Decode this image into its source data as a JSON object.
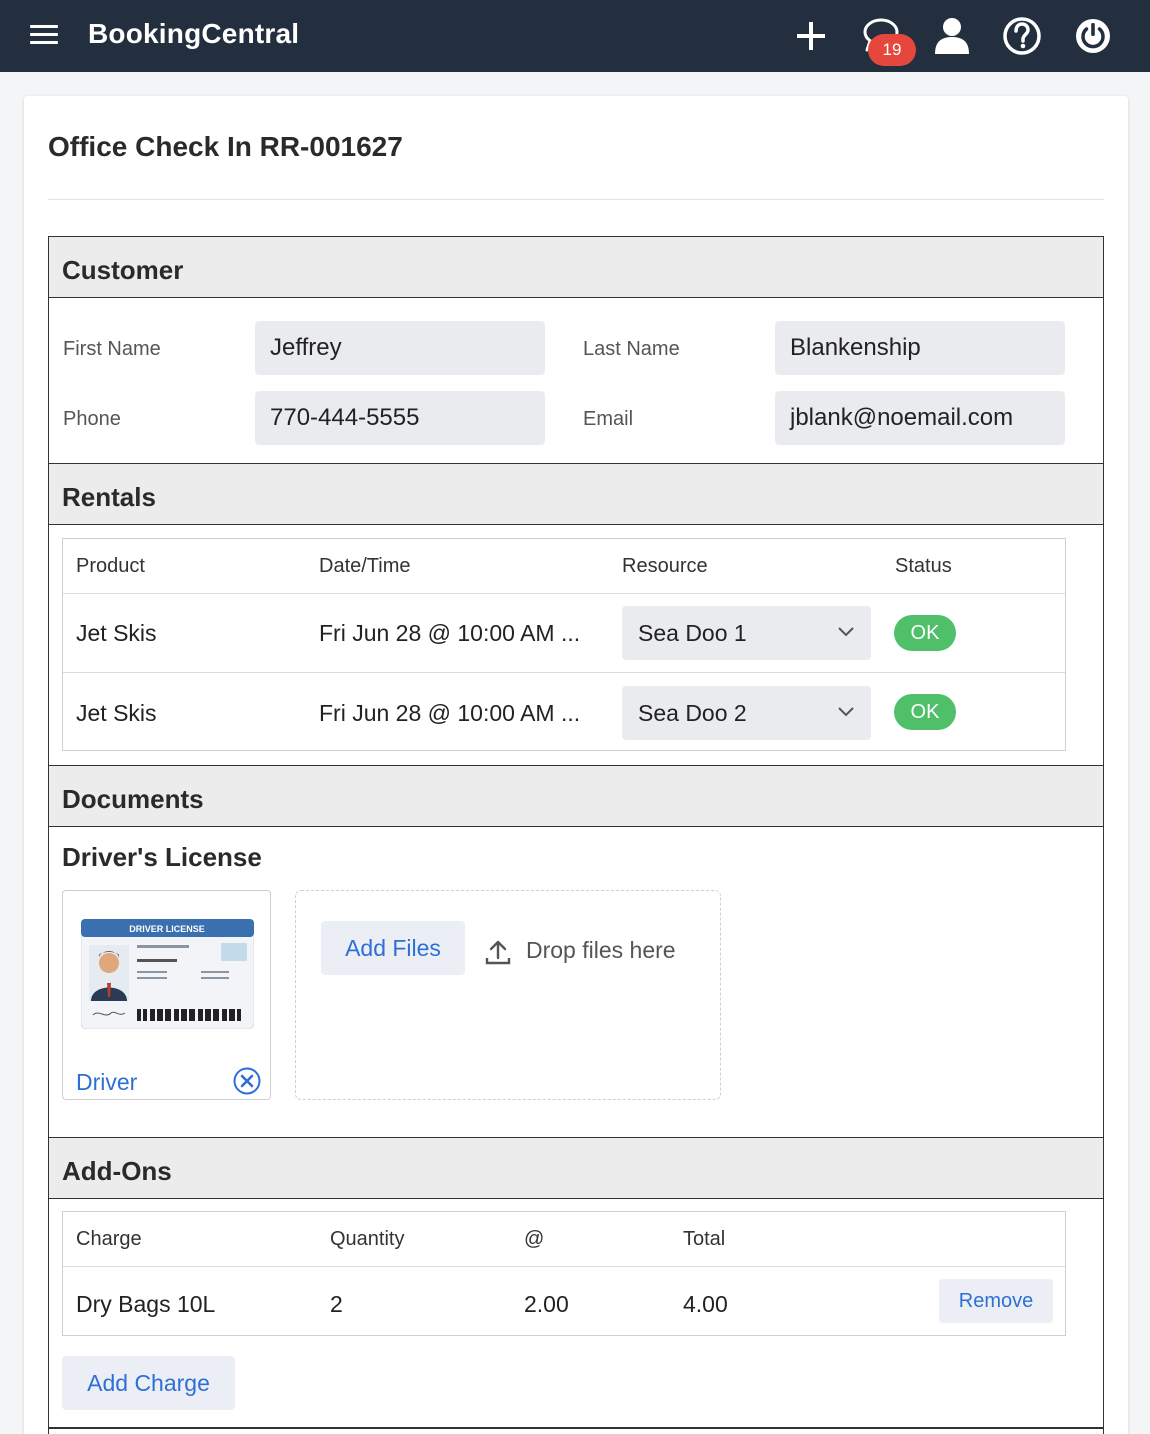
{
  "app": {
    "brand": "BookingCentral",
    "notification_count": "19",
    "icons": [
      "menu-icon",
      "plus-icon",
      "chat-icon",
      "user-icon",
      "help-icon",
      "power-icon"
    ]
  },
  "page": {
    "title": "Office Check In RR-001627"
  },
  "customer": {
    "heading": "Customer",
    "first_name_label": "First Name",
    "first_name": "Jeffrey",
    "last_name_label": "Last Name",
    "last_name": "Blankenship",
    "phone_label": "Phone",
    "phone": "770-444-5555",
    "email_label": "Email",
    "email": "jblank@noemail.com"
  },
  "rentals": {
    "heading": "Rentals",
    "columns": [
      "Product",
      "Date/Time",
      "Resource",
      "Status"
    ],
    "rows": [
      {
        "product": "Jet Skis",
        "datetime": "Fri Jun 28 @ 10:00 AM ...",
        "resource": "Sea Doo 1",
        "status": "OK"
      },
      {
        "product": "Jet Skis",
        "datetime": "Fri Jun 28 @ 10:00 AM ...",
        "resource": "Sea Doo 2",
        "status": "OK"
      }
    ]
  },
  "documents": {
    "heading": "Documents",
    "subheading": "Driver's License",
    "file_label": "Driver",
    "card_title": "DRIVER LICENSE",
    "add_files_label": "Add Files",
    "drop_text": "Drop files here"
  },
  "addons": {
    "heading": "Add-Ons",
    "columns": [
      "Charge",
      "Quantity",
      "@",
      "Total"
    ],
    "rows": [
      {
        "charge": "Dry Bags 10L",
        "quantity": "2",
        "price": "2.00",
        "total": "4.00",
        "remove_label": "Remove"
      }
    ],
    "add_charge_label": "Add Charge"
  },
  "colors": {
    "topbar": "#232f3e",
    "accent": "#2e6fd6",
    "ok": "#4fbf6a",
    "badge": "#e5473d"
  }
}
